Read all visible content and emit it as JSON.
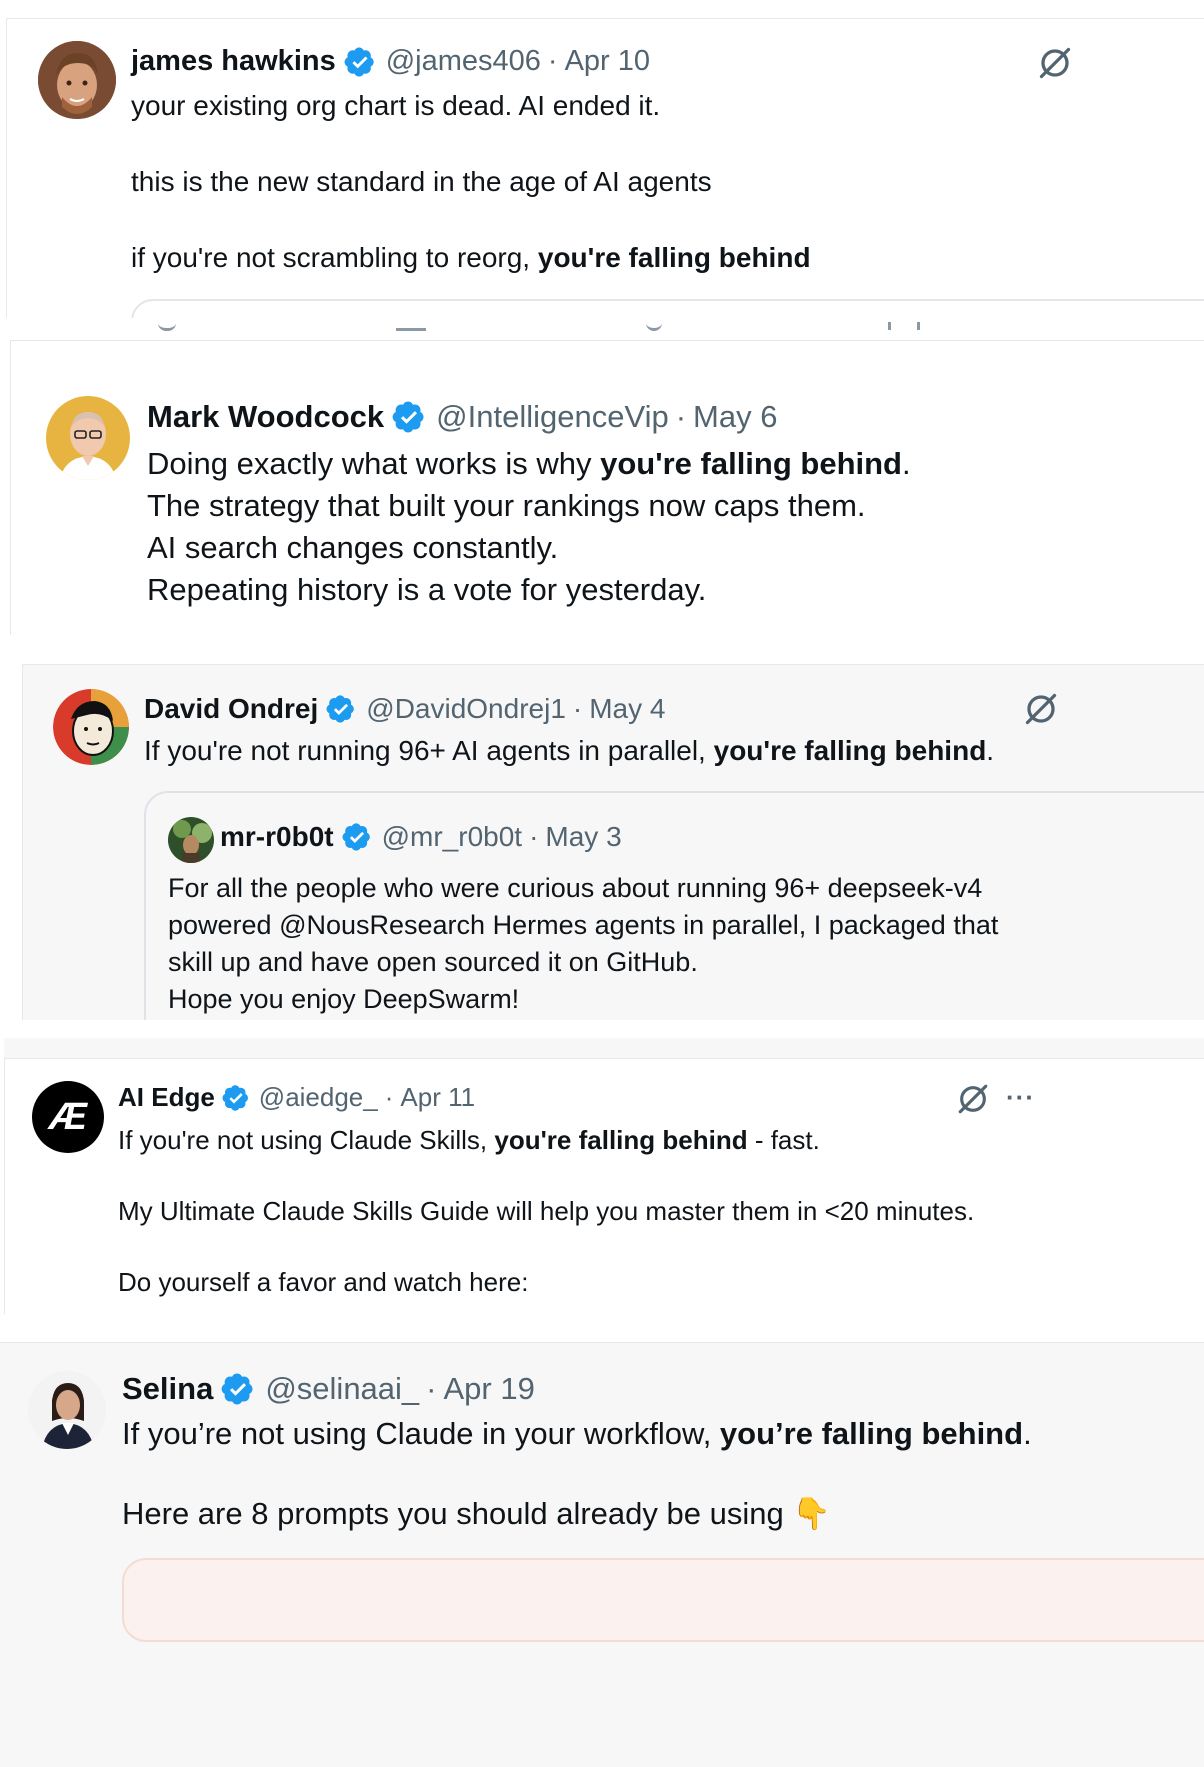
{
  "tweets": [
    {
      "name": "james hawkins",
      "handle": "@james406",
      "date": "Apr 10",
      "line1": "your existing org chart is dead. AI ended it.",
      "line2": "this is the new standard in the age of AI agents",
      "line3_pre": "if you're not scrambling to reorg, ",
      "line3_bold": "you're falling behind"
    },
    {
      "name": "Mark Woodcock",
      "handle": "@IntelligenceVip",
      "date": "May 6",
      "line1_pre": "Doing exactly what works is why ",
      "line1_bold": "you're falling behind",
      "line1_post": ".",
      "line2": "The strategy that built your rankings now caps them.",
      "line3": "AI search changes constantly.",
      "line4": "Repeating history is a vote for yesterday."
    },
    {
      "name": "David Ondrej",
      "handle": "@DavidOndrej1",
      "date": "May 4",
      "line1_pre": "If you're not running 96+ AI agents in parallel, ",
      "line1_bold": "you're falling behind",
      "line1_post": ".",
      "quote": {
        "name": "mr-r0b0t",
        "handle": "@mr_r0b0t",
        "date": "May 3",
        "line1": "For all the people who were curious about running 96+ deepseek-v4",
        "line2": "powered @NousResearch  Hermes agents in parallel, I packaged that",
        "line3": "skill up and have open sourced it on GitHub.",
        "line4": "Hope you enjoy DeepSwarm!"
      }
    },
    {
      "name": "AI Edge",
      "handle": "@aiedge_",
      "date": "Apr 11",
      "avatar_text": "Æ",
      "line1_pre": "If you're not using Claude Skills, ",
      "line1_bold": "you're falling behind",
      "line1_post": " - fast.",
      "line2": "My Ultimate Claude Skills Guide will help you master them in <20 minutes.",
      "line3": "Do yourself a favor and watch here:",
      "more": "···"
    },
    {
      "name": "Selina",
      "handle": "@selinaai_",
      "date": "Apr 19",
      "line1_pre": "If you’re not using Claude in your workflow, ",
      "line1_bold": "you’re falling behind",
      "line1_post": ".",
      "line2": "Here are 8 prompts you should already be using",
      "emoji": "👇"
    }
  ],
  "separator": "·",
  "icons": [
    "verified-badge-icon",
    "grok-icon",
    "more-icon",
    "point-down-emoji"
  ],
  "colors": {
    "verified": "#1d9bf0",
    "meta": "#536471",
    "text": "#0f1419",
    "quote_bg": "#f7f7f8"
  }
}
